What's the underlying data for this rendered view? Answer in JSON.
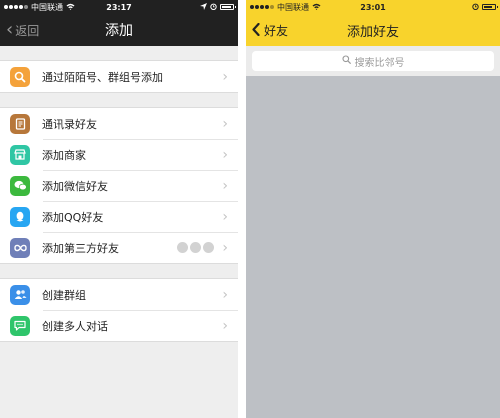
{
  "left": {
    "status": {
      "carrier": "中国联通",
      "time": "23:17"
    },
    "nav": {
      "back_label": "返回",
      "title": "添加"
    },
    "groups": [
      [
        {
          "label": "通过陌陌号、群组号添加",
          "icon": "search-icon",
          "color": "#f4a23b"
        }
      ],
      [
        {
          "label": "通讯录好友",
          "icon": "contacts-book-icon",
          "color": "#b7773a"
        },
        {
          "label": "添加商家",
          "icon": "store-icon",
          "color": "#2fc6a4"
        },
        {
          "label": "添加微信好友",
          "icon": "wechat-icon",
          "color": "#3cb93e"
        },
        {
          "label": "添加QQ好友",
          "icon": "qq-icon",
          "color": "#27a6f2"
        },
        {
          "label": "添加第三方好友",
          "icon": "infinity-icon",
          "color": "#6f7fb8"
        }
      ],
      [
        {
          "label": "创建群组",
          "icon": "group-icon",
          "color": "#3a8fe8"
        },
        {
          "label": "创建多人对话",
          "icon": "chat-icon",
          "color": "#2fc56b"
        }
      ]
    ]
  },
  "right": {
    "status": {
      "carrier": "中国联通",
      "time": "23:01"
    },
    "nav": {
      "back_label": "好友",
      "title": "添加好友"
    },
    "search": {
      "placeholder": "搜索比邻号"
    }
  }
}
